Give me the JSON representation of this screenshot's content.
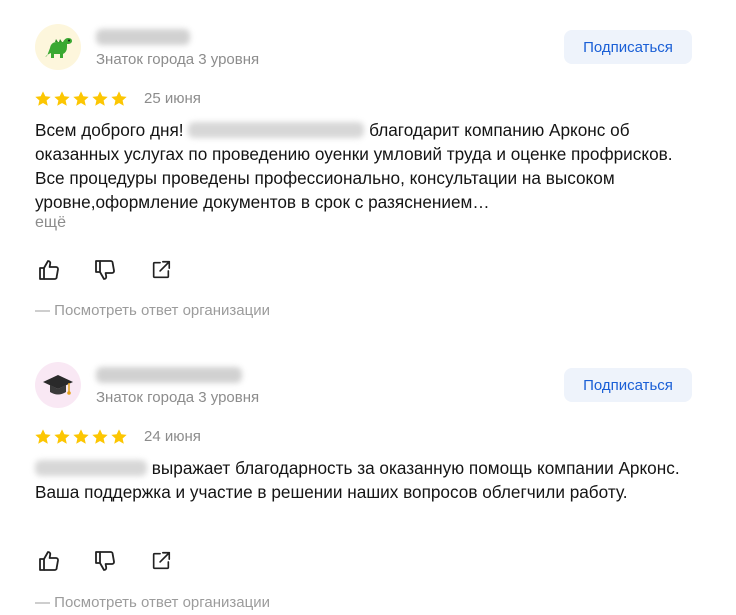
{
  "reviews": [
    {
      "level": "Знаток города 3 уровня",
      "subscribe_label": "Подписаться",
      "date": "25 июня",
      "rating": 5,
      "text_before": "Всем доброго дня!",
      "text_after": " благодарит компанию Арконс об оказанных услугах по проведению оуенки умловий труда и оценке профрисков. Все процедуры проведены профессионально, консультации на высоком уровне,оформление документов в срок с разяснением…",
      "more_label": "ещё",
      "org_reply_label": "— Посмотреть ответ организации",
      "avatar_icon": "dinosaur-icon"
    },
    {
      "level": "Знаток города 3 уровня",
      "subscribe_label": "Подписаться",
      "date": "24 июня",
      "rating": 5,
      "text_before": "",
      "text_after": " выражает благодарность за оказанную помощь компании Арконс. Ваша поддержка и участие в решении наших вопросов облегчили работу.",
      "org_reply_label": "— Посмотреть ответ организации",
      "avatar_icon": "graduation-cap-icon"
    }
  ],
  "colors": {
    "star": "#fcc602",
    "subscribe_text": "#1a5fd6",
    "subscribe_bg": "#eef3fb",
    "muted": "#8c8c8c"
  }
}
